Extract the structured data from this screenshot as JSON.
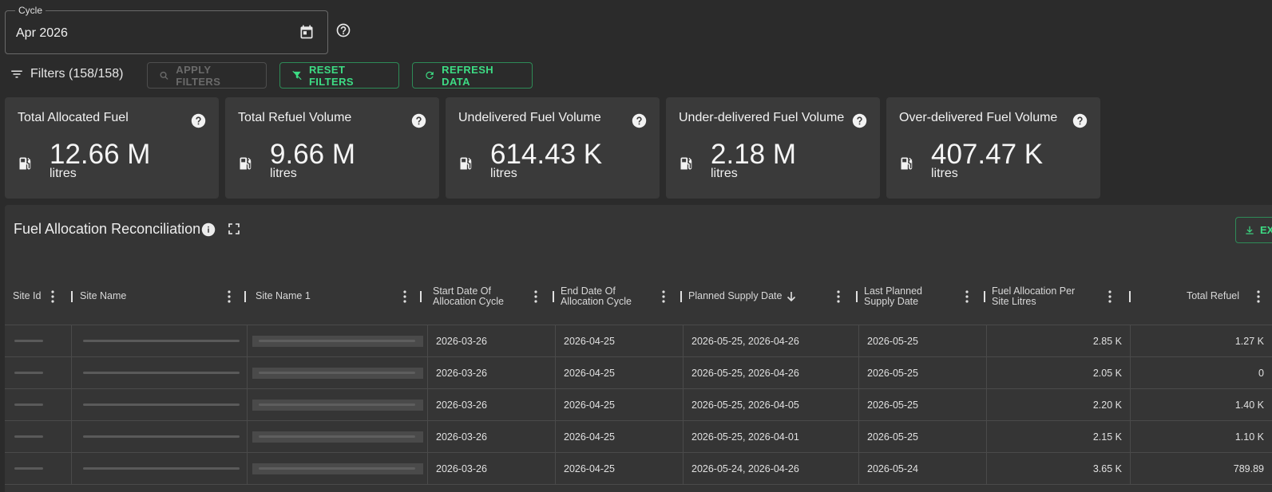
{
  "cycle": {
    "label": "Cycle",
    "value": "Apr 2026"
  },
  "filters": {
    "label": "Filters (158/158)",
    "apply_label": "APPLY FILTERS",
    "reset_label": "RESET FILTERS",
    "refresh_label": "REFRESH DATA"
  },
  "cards": [
    {
      "title": "Total Allocated Fuel",
      "value": "12.66 M",
      "unit": "litres"
    },
    {
      "title": "Total Refuel Volume",
      "value": "9.66 M",
      "unit": "litres"
    },
    {
      "title": "Undelivered Fuel Volume",
      "value": "614.43 K",
      "unit": "litres"
    },
    {
      "title": "Under-delivered Fuel Volume",
      "value": "2.18 M",
      "unit": "litres"
    },
    {
      "title": "Over-delivered Fuel Volume",
      "value": "407.47 K",
      "unit": "litres"
    }
  ],
  "table": {
    "title": "Fuel Allocation Reconciliation",
    "export_label": "EX",
    "columns": [
      "Site Id",
      "Site Name",
      "Site Name 1",
      "Start Date Of Allocation Cycle",
      "End Date Of Allocation Cycle",
      "Planned Supply Date",
      "Last Planned Supply Date",
      "Fuel Allocation Per Site Litres",
      "Total Refuel"
    ],
    "rows": [
      {
        "start": "2026-03-26",
        "end": "2026-04-25",
        "planned": "2026-05-25, 2026-04-26",
        "last": "2026-05-25",
        "alloc": "2.85 K",
        "refuel": "1.27 K"
      },
      {
        "start": "2026-03-26",
        "end": "2026-04-25",
        "planned": "2026-05-25, 2026-04-26",
        "last": "2026-05-25",
        "alloc": "2.05 K",
        "refuel": "0"
      },
      {
        "start": "2026-03-26",
        "end": "2026-04-25",
        "planned": "2026-05-25, 2026-04-05",
        "last": "2026-05-25",
        "alloc": "2.20 K",
        "refuel": "1.40 K"
      },
      {
        "start": "2026-03-26",
        "end": "2026-04-25",
        "planned": "2026-05-25, 2026-04-01",
        "last": "2026-05-25",
        "alloc": "2.15 K",
        "refuel": "1.10 K"
      },
      {
        "start": "2026-03-26",
        "end": "2026-04-25",
        "planned": "2026-05-24, 2026-04-26",
        "last": "2026-05-24",
        "alloc": "3.65 K",
        "refuel": "789.89"
      }
    ]
  },
  "colors": {
    "accent": "#3ddc84",
    "background": "#2b2b2b",
    "card": "#3a3a3a"
  },
  "icons": [
    "calendar-icon",
    "help-icon",
    "filter-icon",
    "search-icon",
    "filter-off-icon",
    "refresh-icon",
    "fuel-pump-icon",
    "info-icon",
    "fullscreen-icon",
    "download-icon",
    "kebab-icon",
    "sort-down-icon"
  ]
}
